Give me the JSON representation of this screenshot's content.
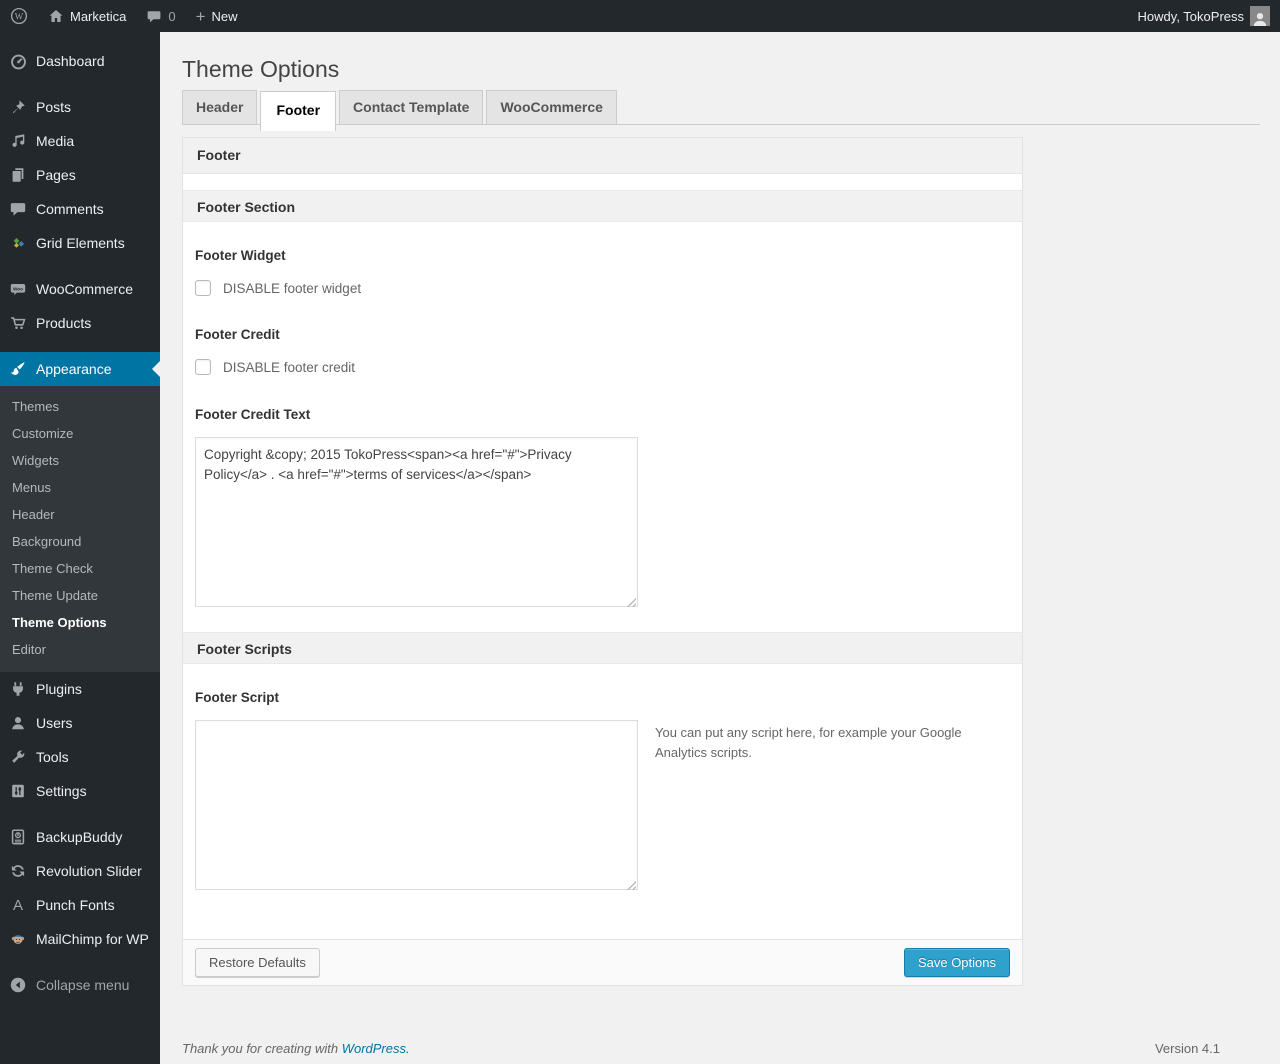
{
  "admin_bar": {
    "site_name": "Marketica",
    "comment_count": "0",
    "new_label": "New",
    "howdy": "Howdy, TokoPress"
  },
  "icons": {
    "wp_logo_glyph": "W",
    "plus_glyph": "+",
    "woo_badge_glyph": "Woo",
    "punch_fonts_glyph": "A"
  },
  "sidebar": {
    "dashboard": "Dashboard",
    "posts": "Posts",
    "media": "Media",
    "pages": "Pages",
    "comments": "Comments",
    "grid_elements": "Grid Elements",
    "woocommerce": "WooCommerce",
    "products": "Products",
    "appearance": "Appearance",
    "submenu": {
      "themes": "Themes",
      "customize": "Customize",
      "widgets": "Widgets",
      "menus": "Menus",
      "header": "Header",
      "background": "Background",
      "theme_check": "Theme Check",
      "theme_update": "Theme Update",
      "theme_options": "Theme Options",
      "editor": "Editor"
    },
    "plugins": "Plugins",
    "users": "Users",
    "tools": "Tools",
    "settings": "Settings",
    "backupbuddy": "BackupBuddy",
    "revolution_slider": "Revolution Slider",
    "punch_fonts": "Punch Fonts",
    "mailchimp": "MailChimp for WP",
    "collapse_menu": "Collapse menu"
  },
  "page": {
    "title": "Theme Options",
    "tabs": {
      "header": "Header",
      "footer": "Footer",
      "contact_template": "Contact Template",
      "woocommerce": "WooCommerce"
    }
  },
  "panel": {
    "group_title": "Footer",
    "footer_section": {
      "title": "Footer Section",
      "footer_widget_label": "Footer Widget",
      "disable_widget_label": "DISABLE footer widget",
      "footer_credit_label": "Footer Credit",
      "disable_credit_label": "DISABLE footer credit",
      "footer_credit_text_label": "Footer Credit Text",
      "footer_credit_text_value": "Copyright &copy; 2015 TokoPress<span><a href=\"#\">Privacy Policy</a> . <a href=\"#\">terms of services</a></span>"
    },
    "footer_scripts": {
      "title": "Footer Scripts",
      "footer_script_label": "Footer Script",
      "footer_script_value": "",
      "helper_text": "You can put any script here, for example your Google Analytics scripts."
    },
    "buttons": {
      "restore": "Restore Defaults",
      "save": "Save Options"
    }
  },
  "footer": {
    "thanks_prefix": "Thank you for creating with ",
    "wordpress_link": "WordPress.",
    "version": "Version 4.1"
  },
  "colors": {
    "admin_dark": "#23282d",
    "accent_blue": "#0074a2",
    "primary_button": "#2ea2cc",
    "page_background": "#f1f1f1"
  }
}
